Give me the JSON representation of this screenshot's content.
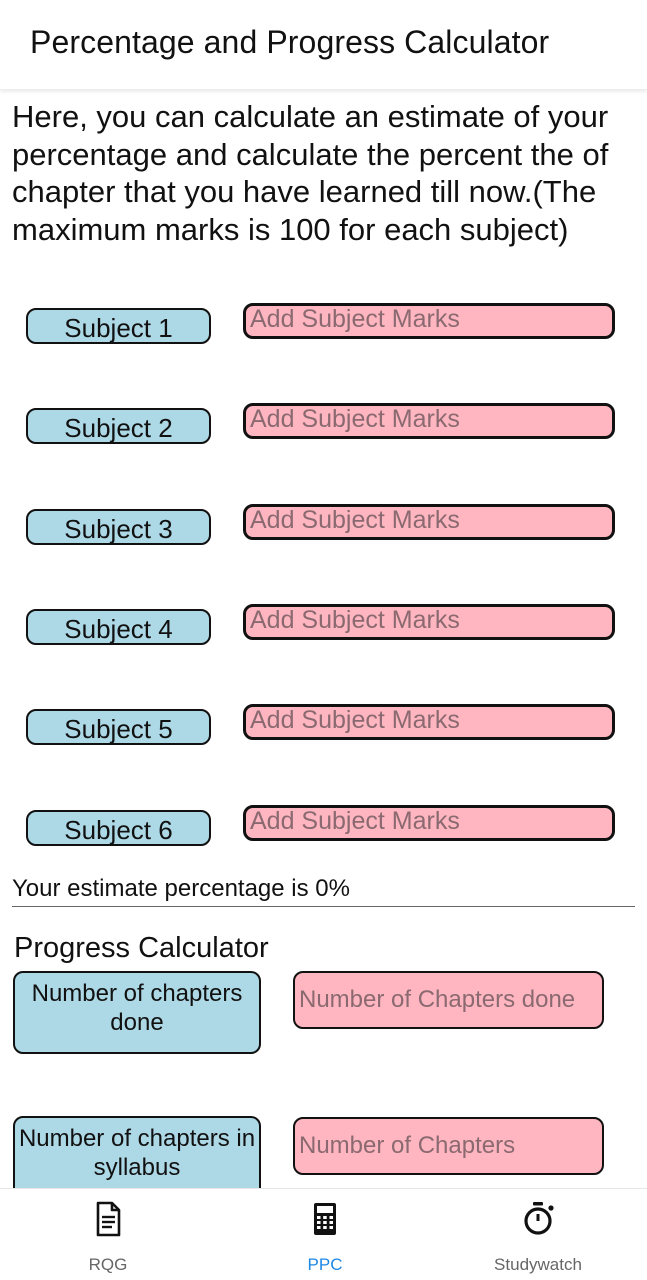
{
  "header": {
    "title": "Percentage and Progress Calculator"
  },
  "intro": "Here, you can calculate an estimate of your percentage and calculate the percent the of chapter that you have learned till now.(The maximum marks is 100 for each subject)",
  "subjects": [
    {
      "label": "Subject 1",
      "placeholder": "Add Subject Marks",
      "value": ""
    },
    {
      "label": "Subject 2",
      "placeholder": "Add Subject Marks",
      "value": ""
    },
    {
      "label": "Subject 3",
      "placeholder": "Add Subject Marks",
      "value": ""
    },
    {
      "label": "Subject 4",
      "placeholder": "Add Subject Marks",
      "value": ""
    },
    {
      "label": "Subject 5",
      "placeholder": "Add Subject Marks",
      "value": ""
    },
    {
      "label": "Subject 6",
      "placeholder": "Add Subject Marks",
      "value": ""
    }
  ],
  "estimate_text": "Your estimate percentage is 0%",
  "progress": {
    "title": "Progress Calculator",
    "chapters_done_label": "Number of chapters done",
    "chapters_done_placeholder": "Number of Chapters done",
    "chapters_total_label": "Number of chapters in syllabus",
    "chapters_total_placeholder": "Number of Chapters"
  },
  "nav": {
    "items": [
      {
        "label": "RQG",
        "icon": "document-icon",
        "active": false
      },
      {
        "label": "PPC",
        "icon": "calculator-icon",
        "active": true
      },
      {
        "label": "Studywatch",
        "icon": "stopwatch-icon",
        "active": false
      }
    ]
  },
  "colors": {
    "label_bg": "#add8e6",
    "input_bg": "#ffb6c1",
    "active_nav": "#1e88e5",
    "inactive_nav": "#666666"
  }
}
